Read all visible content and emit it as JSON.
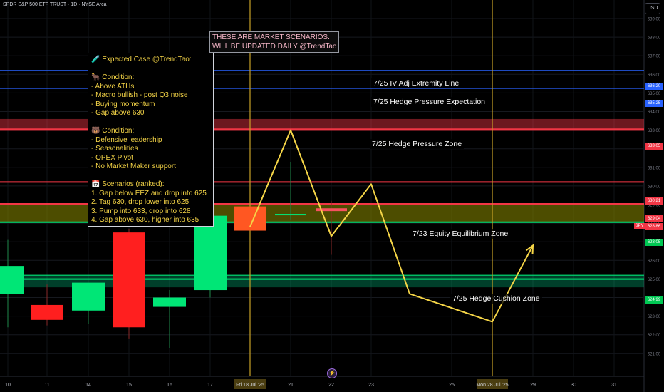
{
  "header": {
    "symbol_title": "SPDR S&P 500 ETF TRUST · 1D · NYSE Arca",
    "currency_button": "USD"
  },
  "banner": {
    "line1": "THESE ARE MARKET SCENARIOS.",
    "line2": "WILL BE UPDATED DAILY @TrendTao"
  },
  "note": {
    "lines": [
      "🧪 Expected Case @TrendTao:",
      "",
      "🐂 Condition:",
      "- Above ATHs",
      "- Macro bullish - post Q3 noise",
      "- Buying momentum",
      "- Gap above 630",
      "",
      "🐻 Condition:",
      "- Defensive leadership",
      "- Seasonalities",
      "- OPEX Pivot",
      "- No Market Maker support",
      "",
      "📅 Scenarios (ranked):",
      "1. Gap below EEZ and drop into 625",
      "2. Tag 630, drop lower into 625",
      "3. Pump into 633, drop into 628",
      "4. Gap above 630, higher into 635"
    ]
  },
  "levels": {
    "iv_line": {
      "label": "7/25 IV Adj Extremity Line",
      "price": 636.2,
      "price_text": "636.20",
      "color": "#2962ff"
    },
    "hedge_expect": {
      "label": "7/25 Hedge Pressure Expectation",
      "price": 635.25,
      "price_text": "635.25",
      "color": "#2962ff"
    },
    "hedge_zone": {
      "label": "7/25 Hedge Pressure Zone",
      "price": 633.05,
      "price_text": "633.05",
      "top": 633.6,
      "bottom": 632.95,
      "color": "#f23645"
    },
    "red_630": {
      "price": 630.21,
      "price_text": "630.21",
      "color": "#f23645"
    },
    "red_629": {
      "price": 629.04,
      "price_text": "629.04",
      "color": "#f23645"
    },
    "eq_zone": {
      "label": "7/23 Equity Equilibrium Zone",
      "top": 629.04,
      "bottom": 628.05,
      "color": "#808000"
    },
    "green_628": {
      "price": 628.05,
      "price_text": "628.05",
      "color": "#00e676"
    },
    "cushion": {
      "label": "7/25 Hedge Cushion Zone",
      "price": 624.99,
      "price_text": "624.99",
      "top": 625.2,
      "bottom": 624.55,
      "color": "#00e676"
    },
    "spy_price": {
      "price": 628.86,
      "price_text": "628.86",
      "tag": "SPY"
    }
  },
  "chart_data": {
    "type": "candlestick",
    "ylim": [
      620.8,
      640
    ],
    "y_ticks": [
      621,
      622,
      623,
      624,
      625,
      626,
      627,
      628,
      629,
      630,
      631,
      632,
      633,
      634,
      635,
      636,
      637,
      638,
      639
    ],
    "x_ticks": [
      "10",
      "11",
      "14",
      "15",
      "16",
      "17",
      "Fri 18 Jul '25",
      "21",
      "22",
      "23",
      "25",
      "Mon 28 Jul '25",
      "29",
      "30",
      "31"
    ],
    "candles": [
      {
        "date": "10",
        "open": 624.2,
        "high": 627.1,
        "low": 622.4,
        "close": 625.7
      },
      {
        "date": "11",
        "open": 623.6,
        "high": 624.7,
        "low": 622.5,
        "close": 622.8
      },
      {
        "date": "14",
        "open": 623.3,
        "high": 624.6,
        "low": 622.6,
        "close": 624.8
      },
      {
        "date": "15",
        "open": 627.5,
        "high": 627.7,
        "low": 621.8,
        "close": 622.4
      },
      {
        "date": "16",
        "open": 623.5,
        "high": 624.4,
        "low": 621.3,
        "close": 624.0
      },
      {
        "date": "17",
        "open": 624.4,
        "high": 628.4,
        "low": 624.0,
        "close": 628.4
      },
      {
        "date": "Fri 18 Jul '25",
        "open": 628.9,
        "high": 628.9,
        "low": 627.6,
        "close": 627.6
      },
      {
        "date": "21",
        "open": 628.5,
        "high": 631.3,
        "low": 628.2,
        "close": 628.5
      },
      {
        "date": "22",
        "open": 628.8,
        "high": 629.2,
        "low": 626.3,
        "close": 628.65
      }
    ],
    "projection": {
      "color": "#f5d547",
      "points": [
        [
          "Fri 18 Jul '25",
          627.8
        ],
        [
          "21",
          633.0
        ],
        [
          "22",
          627.3
        ],
        [
          "23",
          630.1
        ],
        [
          "24",
          624.2
        ],
        [
          "Mon 28 Jul '25",
          622.7
        ],
        [
          "29",
          626.8
        ]
      ],
      "arrow": true
    },
    "grid": true,
    "highlight_dates": [
      "Fri 18 Jul '25",
      "Mon 28 Jul '25"
    ]
  }
}
